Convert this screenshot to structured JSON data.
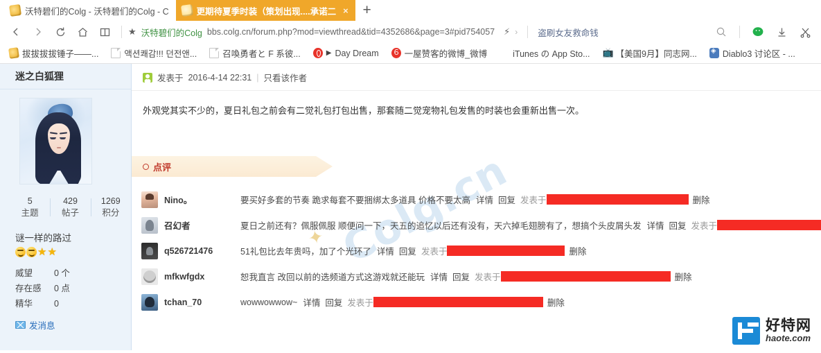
{
  "browser": {
    "tabs": [
      {
        "title": "沃特碧们的Colg - 沃特碧们的Colg - C",
        "favicon": "colg-icon",
        "active": false
      },
      {
        "title": "更期待夏季时装（策划出现....承诺二",
        "favicon": "colg-icon",
        "active": true,
        "close_label": "×"
      }
    ],
    "new_tab_label": "+",
    "nav": {
      "back_icon": "back-arrow-icon",
      "forward_icon": "forward-arrow-icon",
      "reload_icon": "reload-icon",
      "home_icon": "home-icon",
      "reading_list_icon": "book-icon"
    },
    "address": {
      "star_icon": "bookmark-star-icon",
      "site_name": "沃特碧们的Colg",
      "url": "bbs.colg.cn/forum.php?mod=viewthread&tid=4352686&page=3#pid754057",
      "flash_icon": "flash-icon",
      "chevron_icon": "chevron-right-icon"
    },
    "search_term": "盗刷女友救命钱",
    "right_icons": [
      "search-icon",
      "wechat-icon",
      "download-icon",
      "scissors-icon"
    ],
    "bookmarks": [
      {
        "label": "拔拔拔拔锤子——...",
        "icon": "colg-icon"
      },
      {
        "label": "액션쾌감!!! 던전앤...",
        "icon": "page-icon"
      },
      {
        "label": "召喚勇者と F 系彼...",
        "icon": "page-icon"
      },
      {
        "label": "Day Dream",
        "icon": "music-icon"
      },
      {
        "label": "一屋赞客的微博_微博",
        "icon": "weibo-icon"
      },
      {
        "label": "iTunes の App Sto...",
        "icon": "apple-icon"
      },
      {
        "label": "【美国9月】同志网...",
        "icon": "tv-icon"
      },
      {
        "label": "Diablo3 讨论区 - ...",
        "icon": "diablo-icon"
      }
    ]
  },
  "sidebar": {
    "username": "迷之白狐狸",
    "avatar_alt": "user-avatar",
    "stats": [
      {
        "num": "5",
        "label": "主题"
      },
      {
        "num": "429",
        "label": "帖子"
      },
      {
        "num": "1269",
        "label": "积分"
      }
    ],
    "rank_title": "谜一样的路过",
    "rank_icons": [
      "smiley-icon",
      "smiley-icon",
      "star-icon",
      "star-icon"
    ],
    "attributes": [
      {
        "key": "威望",
        "value": "0 个"
      },
      {
        "key": "存在感",
        "value": "0 点"
      },
      {
        "key": "精华",
        "value": "0"
      }
    ],
    "message_button": "发消息",
    "message_icon": "envelope-icon"
  },
  "post": {
    "author_icon": "user-badge-icon",
    "posted_prefix": "发表于",
    "posted_date": "2016-4-14 22:31",
    "separator": "|",
    "only_author_link": "只看该作者",
    "body": "外观党其实不少的，夏日礼包之前会有二觉礼包打包出售，那套随二觉宠物礼包发售的时装也会重新出售一次。",
    "watermark": "Colg.cn",
    "watermark_star": "✦"
  },
  "comments": {
    "banner_label": "点评",
    "banner_icon": "circle-icon",
    "detail_label": "详情",
    "reply_label": "回复",
    "posted_label": "发表于",
    "delete_label": "删除",
    "rows": [
      {
        "avatar": "avatar-nino",
        "name": "Nino。",
        "text": "要买好多套的节奏 跪求每套不要捆绑太多道具 价格不要太高",
        "redaction_width": 205,
        "has_delete": true
      },
      {
        "avatar": "avatar-zhaohuanzhe",
        "name": "召幻者",
        "text": "夏日之前还有？佩服佩服 顺便问一下，天五的追忆以后还有没有，天六掉毛翅膀有了，想搞个头皮屑头发",
        "redaction_width": 200,
        "has_delete": false
      },
      {
        "avatar": "avatar-q526721476",
        "name": "q526721476",
        "text": "51礼包比去年贵吗，加了个光环了",
        "redaction_width": 170,
        "has_delete": true
      },
      {
        "avatar": "avatar-mfkwfgdx",
        "name": "mfkwfgdx",
        "text": "恕我直言 改回以前的选频道方式这游戏就还能玩",
        "redaction_width": 245,
        "has_delete": true
      },
      {
        "avatar": "avatar-tchan70",
        "name": "tchan_70",
        "text": "wowwowwow~",
        "redaction_width": 245,
        "has_delete": true
      }
    ]
  },
  "overlay_logo": {
    "cn": "好特网",
    "en": "haote.com",
    "mark": "haote-h-icon"
  },
  "colors": {
    "active_tab": "#f0a72a",
    "sidebar_bg": "#ecf3fa",
    "banner_bg": "#fbead2",
    "banner_text": "#c0392b",
    "redaction": "#f52b24",
    "link_green": "#3f9142",
    "logo_blue": "#1b8ad6"
  }
}
